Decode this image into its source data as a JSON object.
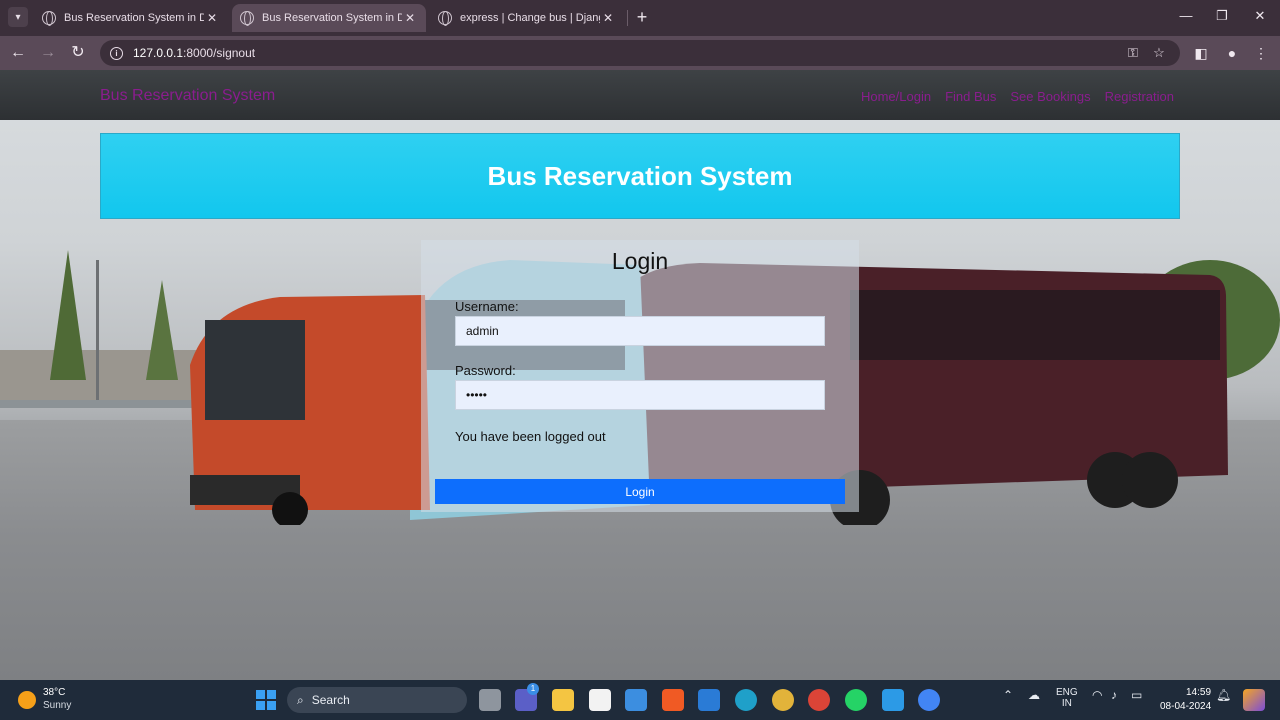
{
  "browser": {
    "tabs": [
      {
        "title": "Bus Reservation System in Django",
        "active": false
      },
      {
        "title": "Bus Reservation System in Django",
        "active": true
      },
      {
        "title": "express | Change bus | Django site admin",
        "active": false
      }
    ],
    "url_host": "127.0.0.1",
    "url_path": ":8000/signout"
  },
  "site": {
    "brand": "Bus Reservation System",
    "nav": [
      "Home/Login",
      "Find Bus",
      "See Bookings",
      "Registration"
    ],
    "hero_title": "Bus Reservation System"
  },
  "login": {
    "title": "Login",
    "username_label": "Username:",
    "username_value": "admin",
    "password_label": "Password:",
    "password_value": "•••••",
    "message": "You have been logged out",
    "button_label": "Login"
  },
  "taskbar": {
    "temperature": "38°C",
    "condition": "Sunny",
    "search_label": "Search",
    "lang_top": "ENG",
    "lang_bottom": "IN",
    "time": "14:59",
    "date": "08-04-2024",
    "badge_count": "1"
  },
  "colors": {
    "brand": "#8a1d8e",
    "hero": "#12c7ee",
    "primary_button": "#0d6efd"
  }
}
